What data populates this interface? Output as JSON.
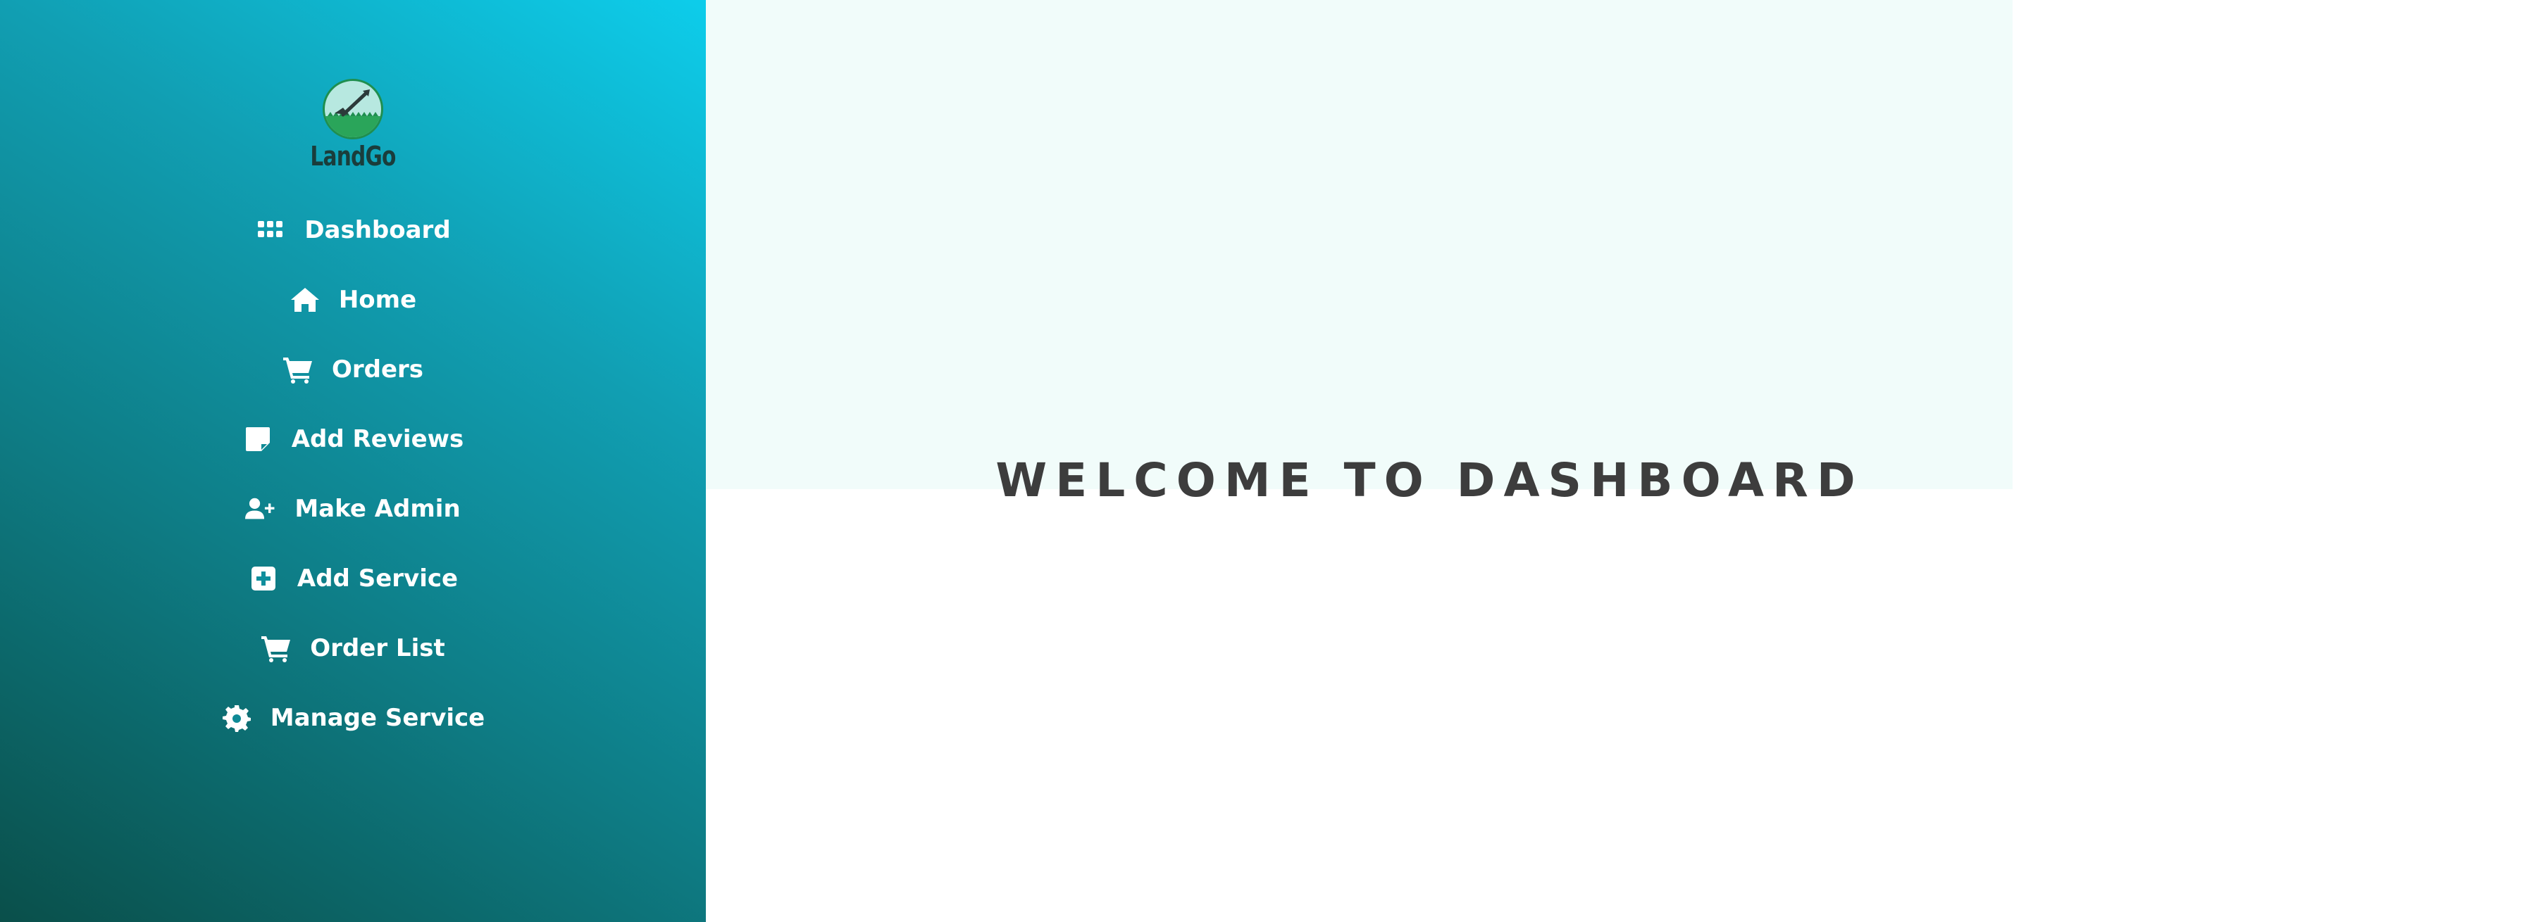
{
  "brand": {
    "name": "LandGo",
    "logo_icon": "shovel-in-grass-icon",
    "logo_colors": {
      "ring": "#1f8f4f",
      "background": "#b7e8e0",
      "grass": "#2aa55a",
      "shovel": "#2c3a3a"
    }
  },
  "sidebar": {
    "gradient": [
      "#0a4f4a",
      "#0e7d86",
      "#119fb3",
      "#0dcdeb"
    ],
    "items": [
      {
        "label": "Dashboard",
        "icon": "grid-icon"
      },
      {
        "label": "Home",
        "icon": "home-icon"
      },
      {
        "label": "Orders",
        "icon": "cart-icon"
      },
      {
        "label": "Add Reviews",
        "icon": "note-icon"
      },
      {
        "label": "Make Admin",
        "icon": "user-plus-icon"
      },
      {
        "label": "Add Service",
        "icon": "plus-square-icon"
      },
      {
        "label": "Order List",
        "icon": "cart-icon"
      },
      {
        "label": "Manage Service",
        "icon": "gear-icon"
      }
    ]
  },
  "main": {
    "title": "WELCOME TO DASHBOARD",
    "hero_background": "#f1fcfa",
    "title_color": "#3d3d3d"
  }
}
